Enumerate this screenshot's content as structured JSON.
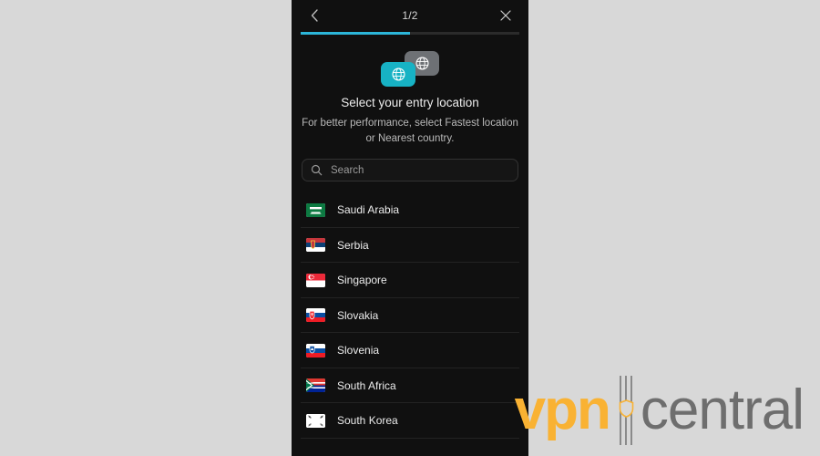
{
  "window": {
    "background_color": "#d8d8d8",
    "panel_background_color": "#101010",
    "accent_color": "#2cb6d9"
  },
  "header": {
    "back_icon": "chevron-left-icon",
    "step_counter": "1/2",
    "close_icon": "close-icon",
    "progress_percent": 50
  },
  "hero": {
    "icon": "globe-tiles-icon",
    "front_tile_color": "#17b2c4",
    "back_tile_color": "#6e7175",
    "title": "Select your entry location",
    "subtitle": "For better performance, select Fastest location or Nearest country."
  },
  "search": {
    "icon": "search-icon",
    "placeholder": "Search",
    "value": ""
  },
  "country_list": [
    {
      "name": "Saudi Arabia",
      "flag": "flag-saudi-arabia"
    },
    {
      "name": "Serbia",
      "flag": "flag-serbia"
    },
    {
      "name": "Singapore",
      "flag": "flag-singapore"
    },
    {
      "name": "Slovakia",
      "flag": "flag-slovakia"
    },
    {
      "name": "Slovenia",
      "flag": "flag-slovenia"
    },
    {
      "name": "South Africa",
      "flag": "flag-south-africa"
    },
    {
      "name": "South Korea",
      "flag": "flag-south-korea"
    }
  ],
  "watermark": {
    "text_primary": "vpn",
    "text_secondary": "central",
    "primary_color": "#f9b233",
    "secondary_color": "#6e6e6e",
    "shield_icon": "shield-icon"
  }
}
